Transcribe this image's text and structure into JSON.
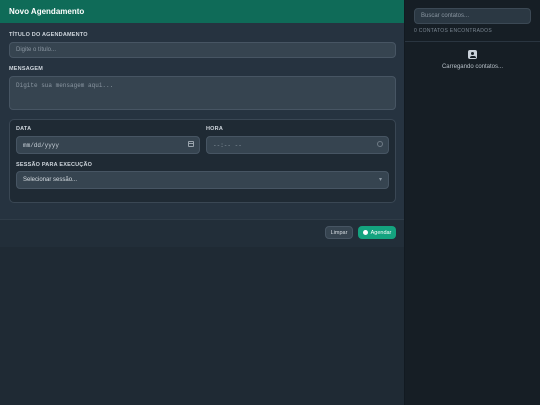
{
  "header": {
    "title": "Novo Agendamento"
  },
  "form": {
    "title_label": "TÍTULO DO AGENDAMENTO",
    "title_placeholder": "Digite o título...",
    "message_label": "MENSAGEM",
    "message_placeholder": "Digite sua mensagem aqui...",
    "date_label": "DATA",
    "date_value": "mm/dd/yyyy",
    "time_label": "HORA",
    "time_value": "--:-- --",
    "session_label": "SESSÃO PARA EXECUÇÃO",
    "session_value": "Selecionar sessão..."
  },
  "footer": {
    "clear_label": "Limpar",
    "schedule_label": "Agendar"
  },
  "sidebar": {
    "search_placeholder": "Buscar contatos...",
    "count_text": "0 CONTATOS ENCONTRADOS",
    "loading_text": "Carregando contatos..."
  },
  "icons": [
    "calendar-icon",
    "clock-icon",
    "chevron-down-icon",
    "contact-icon",
    "circle-icon"
  ],
  "colors": {
    "header": "#0f6b58",
    "accent": "#14a37f"
  }
}
